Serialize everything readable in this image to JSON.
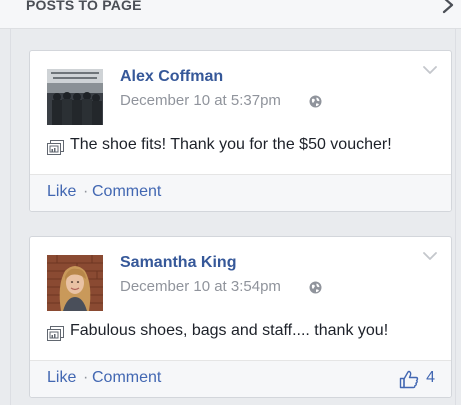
{
  "section": {
    "title": "POSTS TO PAGE"
  },
  "posts": [
    {
      "author": "Alex Coffman",
      "time": "December 10 at 5:37pm",
      "text": "The shoe fits! Thank you for the $50 voucher!",
      "actions": {
        "like": "Like",
        "separator": "·",
        "comment": "Comment"
      },
      "like_count": ""
    },
    {
      "author": "Samantha King",
      "time": "December 10 at 3:54pm",
      "text": "Fabulous shoes, bags and staff.... thank you!",
      "actions": {
        "like": "Like",
        "separator": "·",
        "comment": "Comment"
      },
      "like_count": "4"
    }
  ],
  "colors": {
    "link": "#365899",
    "action": "#4267b2",
    "muted": "#90949c"
  },
  "icons": [
    "chevron-right-icon",
    "globe-icon",
    "chevron-down-icon",
    "photo-post-icon",
    "thumbs-up-icon"
  ]
}
